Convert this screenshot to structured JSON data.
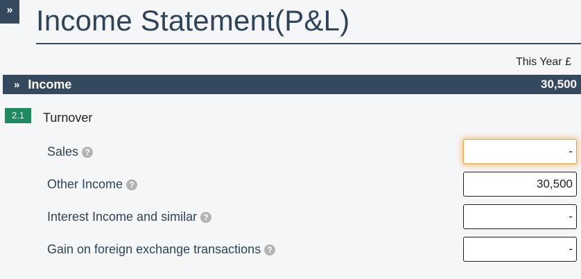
{
  "expand_icon": "»",
  "title": "Income Statement(P&L)",
  "column_header": "This Year £",
  "section": {
    "label": "Income",
    "total": "30,500",
    "chevron_icon": "double-chevron-down-icon"
  },
  "group": {
    "badge": "2.1",
    "label": "Turnover"
  },
  "rows": [
    {
      "label": "Sales",
      "value": "-",
      "focused": true
    },
    {
      "label": "Other Income",
      "value": "30,500",
      "focused": false
    },
    {
      "label": "Interest Income and similar",
      "value": "-",
      "focused": false
    },
    {
      "label": "Gain on foreign exchange transactions",
      "value": "-",
      "focused": false
    }
  ],
  "help_icon": "?",
  "colors": {
    "header_bar": "#34495e",
    "badge_green": "#1d8a5f",
    "focus_glow": "#e8a33c"
  }
}
